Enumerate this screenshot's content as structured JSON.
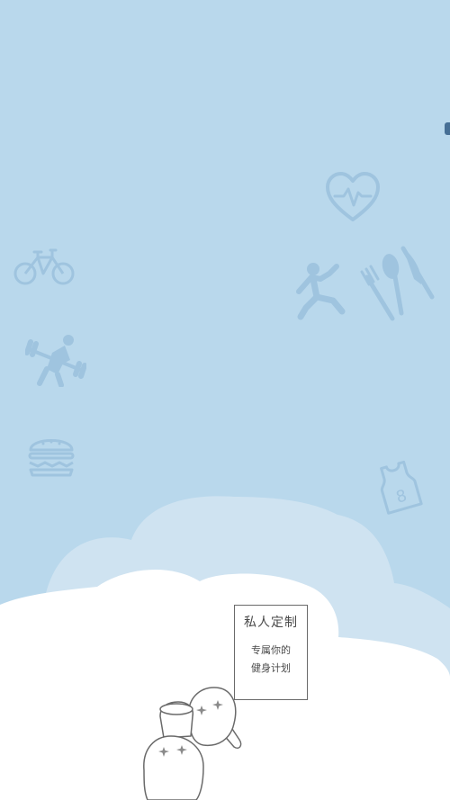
{
  "sign": {
    "title": "私人定制",
    "subtitle_line1": "专属你的",
    "subtitle_line2": "健身计划"
  },
  "icons": [
    "heart-rate-icon",
    "bicycle-icon",
    "running-person-icon",
    "fork-spoon-knife-icon",
    "weightlifting-icon",
    "burger-icon",
    "jersey-icon"
  ],
  "colors": {
    "sky": "#b9d8ec",
    "icon": "#9fc4df",
    "cloud_back": "#cfe3f1",
    "cloud_front": "#ffffff",
    "line": "#6a6a6a",
    "corner_mark": "#466f95"
  }
}
